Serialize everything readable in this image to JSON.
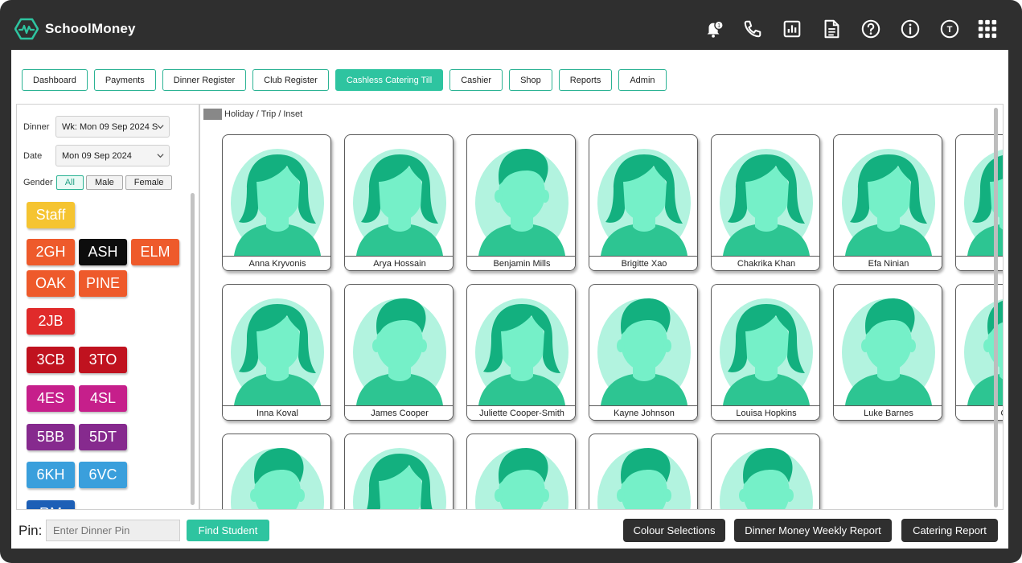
{
  "app": {
    "brand": "SchoolMoney",
    "notification_count": "1"
  },
  "header_icons": [
    {
      "name": "bell-notification-icon"
    },
    {
      "name": "phone-icon"
    },
    {
      "name": "chart-report-icon"
    },
    {
      "name": "document-icon"
    },
    {
      "name": "help-icon"
    },
    {
      "name": "info-icon"
    },
    {
      "name": "user-initial-icon",
      "text": "T"
    },
    {
      "name": "apps-grid-icon"
    }
  ],
  "nav": {
    "tabs": [
      {
        "label": "Dashboard",
        "active": false
      },
      {
        "label": "Payments",
        "active": false
      },
      {
        "label": "Dinner Register",
        "active": false
      },
      {
        "label": "Club Register",
        "active": false
      },
      {
        "label": "Cashless Catering Till",
        "active": true
      },
      {
        "label": "Cashier",
        "active": false
      },
      {
        "label": "Shop",
        "active": false
      },
      {
        "label": "Reports",
        "active": false
      },
      {
        "label": "Admin",
        "active": false
      }
    ]
  },
  "filters": {
    "dinner_label": "Dinner",
    "dinner_value": "Wk: Mon 09 Sep 2024 S",
    "date_label": "Date",
    "date_value": "Mon 09 Sep 2024",
    "gender_label": "Gender",
    "gender_options": [
      "All",
      "Male",
      "Female"
    ],
    "gender_selected": "All"
  },
  "classes": [
    {
      "label": "Staff",
      "color": "#f5c431"
    },
    {
      "label": "2GH",
      "color": "#ee5a2b"
    },
    {
      "label": "ASH",
      "color": "#0d0d0d"
    },
    {
      "label": "ELM",
      "color": "#ee5a2b"
    },
    {
      "label": "OAK",
      "color": "#ee5a2b"
    },
    {
      "label": "PINE",
      "color": "#ee5a2b"
    },
    {
      "label": "2JB",
      "color": "#e02b2b"
    },
    {
      "label": "3CB",
      "color": "#c0121f"
    },
    {
      "label": "3TO",
      "color": "#c0121f"
    },
    {
      "label": "4ES",
      "color": "#c61f8b"
    },
    {
      "label": "4SL",
      "color": "#c61f8b"
    },
    {
      "label": "5BB",
      "color": "#862a8e"
    },
    {
      "label": "5DT",
      "color": "#862a8e"
    },
    {
      "label": "6KH",
      "color": "#3a9fdc"
    },
    {
      "label": "6VC",
      "color": "#3a9fdc"
    },
    {
      "label": "RM",
      "color": "#1d5fb6"
    }
  ],
  "legend": {
    "label": "Holiday / Trip / Inset",
    "color": "#888888"
  },
  "students": [
    {
      "name": "Anna Kryvonis",
      "avatar": "female"
    },
    {
      "name": "Arya Hossain",
      "avatar": "female"
    },
    {
      "name": "Benjamin Mills",
      "avatar": "male"
    },
    {
      "name": "Brigitte Xao",
      "avatar": "female"
    },
    {
      "name": "Chakrika Khan",
      "avatar": "female"
    },
    {
      "name": "Efa Ninian",
      "avatar": "female"
    },
    {
      "name": "Hrik",
      "avatar": "female"
    },
    {
      "name": "Inna Koval",
      "avatar": "female"
    },
    {
      "name": "James Cooper",
      "avatar": "male"
    },
    {
      "name": "Juliette Cooper-Smith",
      "avatar": "female"
    },
    {
      "name": "Kayne Johnson",
      "avatar": "male"
    },
    {
      "name": "Louisa Hopkins",
      "avatar": "female"
    },
    {
      "name": "Luke Barnes",
      "avatar": "male"
    },
    {
      "name": "Olive",
      "avatar": "male"
    },
    {
      "name": "",
      "avatar": "male"
    },
    {
      "name": "",
      "avatar": "female"
    },
    {
      "name": "",
      "avatar": "male"
    },
    {
      "name": "",
      "avatar": "male"
    },
    {
      "name": "",
      "avatar": "male"
    }
  ],
  "bottom": {
    "pin_label": "Pin:",
    "pin_placeholder": "Enter Dinner Pin",
    "find_button": "Find Student",
    "colour_button": "Colour Selections",
    "weekly_report_button": "Dinner Money Weekly Report",
    "catering_report_button": "Catering Report"
  },
  "colors": {
    "accent": "#2ec4a0",
    "avatar_bg": "#b2f3df",
    "avatar_face": "#75f0c8",
    "avatar_hair": "#13b07f",
    "avatar_shirt": "#2dc592",
    "dark": "#2f2f2f"
  }
}
